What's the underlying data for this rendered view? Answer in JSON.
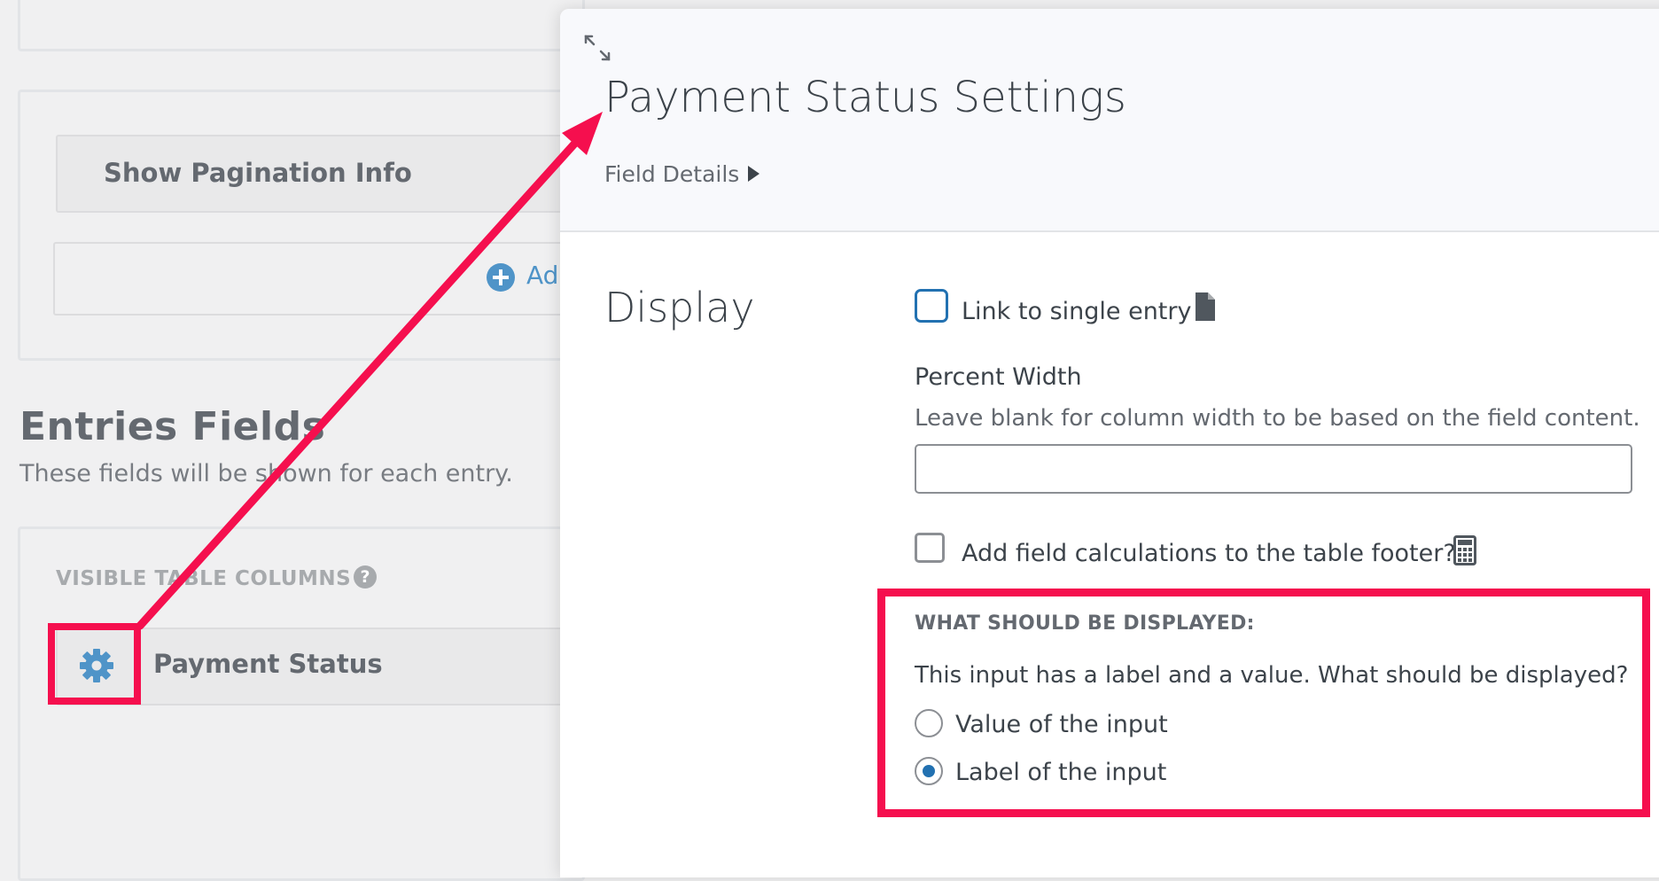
{
  "background": {
    "pagination": {
      "label": "Show Pagination Info"
    },
    "add_field": {
      "label": "Ad"
    },
    "entries": {
      "title": "Entries Fields",
      "description": "These fields will be shown for each entry."
    },
    "visible_columns": {
      "heading": "VISIBLE TABLE COLUMNS",
      "help_icon": "?",
      "field_label": "Payment Status"
    }
  },
  "modal": {
    "title": "Payment Status Settings",
    "field_details": "Field Details",
    "display_section": "Display",
    "link_checkbox": {
      "label": "Link to single entry",
      "checked": false
    },
    "percent_width": {
      "label": "Percent Width",
      "help": "Leave blank for column width to be based on the field content.",
      "value": ""
    },
    "calc_checkbox": {
      "label": "Add field calculations to the table footer?",
      "checked": false
    },
    "display_choice": {
      "heading": "WHAT SHOULD BE DISPLAYED:",
      "question": "This input has a label and a value. What should be displayed?",
      "options": [
        {
          "label": "Value of the input",
          "selected": false
        },
        {
          "label": "Label of the input",
          "selected": true
        }
      ]
    }
  },
  "colors": {
    "annotation": "#f50f4e",
    "accent": "#2271b1",
    "gear": "#4f94c8"
  }
}
